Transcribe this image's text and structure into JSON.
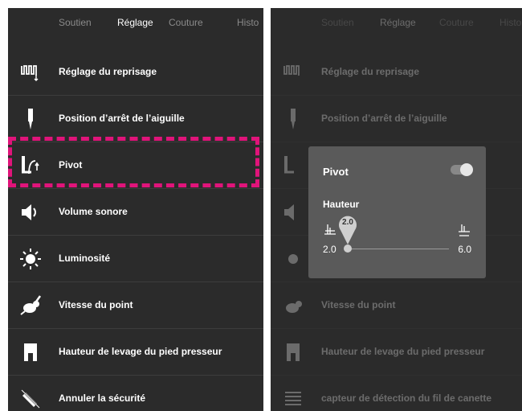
{
  "tabs": [
    "Soutien",
    "Réglage",
    "Couture",
    "Histo"
  ],
  "left_menu": [
    {
      "label": "Réglage du reprisage",
      "icon": "darning-icon"
    },
    {
      "label": "Position d’arrêt de l’aiguille",
      "icon": "needle-icon"
    },
    {
      "label": "Pivot",
      "icon": "pivot-icon"
    },
    {
      "label": "Volume sonore",
      "icon": "speaker-icon"
    },
    {
      "label": "Luminosité",
      "icon": "brightness-icon"
    },
    {
      "label": "Vitesse du point",
      "icon": "rabbit-icon"
    },
    {
      "label": "Hauteur de levage du pied presseur",
      "icon": "presser-foot-icon"
    },
    {
      "label": "Annuler la sécurité",
      "icon": "security-off-icon"
    }
  ],
  "right_menu": [
    {
      "label": "Réglage du reprisage"
    },
    {
      "label": "Position d’arrêt de l’aiguille"
    },
    {
      "label": ""
    },
    {
      "label": ""
    },
    {
      "label": ""
    },
    {
      "label": "Vitesse du point"
    },
    {
      "label": "Hauteur de levage du pied presseur"
    },
    {
      "label": "capteur de détection du fil de canette",
      "icon": "bobbin-sensor-icon"
    }
  ],
  "popup": {
    "title": "Pivot",
    "toggle_on": true,
    "subtitle": "Hauteur",
    "slider": {
      "min": "2.0",
      "max": "6.0",
      "value": "2.0"
    }
  },
  "colors": {
    "highlight": "#e0147a",
    "panel_bg": "#2b2b2b",
    "popup_bg": "#5a5a5a"
  }
}
